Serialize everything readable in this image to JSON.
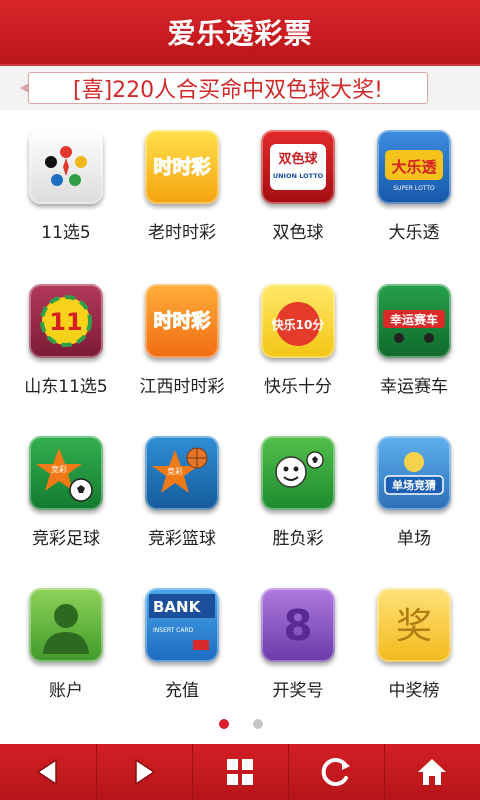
{
  "header": {
    "title": "爱乐透彩票"
  },
  "ticker": {
    "text": "[喜]220人合买命中双色球大奖!"
  },
  "games": [
    {
      "label": "11选5",
      "icon": "11x5-logo-icon"
    },
    {
      "label": "老时时彩",
      "icon": "shishicai-logo-icon",
      "icon_text": "时时彩"
    },
    {
      "label": "双色球",
      "icon": "union-lotto-logo-icon",
      "icon_text": "双色球",
      "icon_sub": "UNION LOTTO"
    },
    {
      "label": "大乐透",
      "icon": "super-lotto-logo-icon",
      "icon_text": "大乐透",
      "icon_sub": "SUPER LOTTO"
    },
    {
      "label": "山东11选5",
      "icon": "shandong-11x5-logo-icon",
      "icon_text": "11"
    },
    {
      "label": "江西时时彩",
      "icon": "jiangxi-shishicai-logo-icon",
      "icon_text": "时时彩"
    },
    {
      "label": "快乐十分",
      "icon": "kuaile-shifen-logo-icon",
      "icon_text": "快乐10分"
    },
    {
      "label": "幸运赛车",
      "icon": "lucky-racing-logo-icon",
      "icon_text": "幸运赛车"
    },
    {
      "label": "竞彩足球",
      "icon": "soccer-logo-icon",
      "icon_text": "竞彩"
    },
    {
      "label": "竞彩篮球",
      "icon": "basketball-logo-icon",
      "icon_text": "竞彩"
    },
    {
      "label": "胜负彩",
      "icon": "win-lose-logo-icon"
    },
    {
      "label": "单场",
      "icon": "single-match-logo-icon",
      "icon_text": "单场竞猜"
    },
    {
      "label": "账户",
      "icon": "account-icon"
    },
    {
      "label": "充值",
      "icon": "bank-card-icon",
      "icon_text": "BANK",
      "icon_sub": "INSERT CARD"
    },
    {
      "label": "开奖号",
      "icon": "draw-number-icon",
      "icon_text": "8"
    },
    {
      "label": "中奖榜",
      "icon": "prize-list-icon",
      "icon_text": "奖"
    }
  ],
  "pager": {
    "total": 2,
    "active": 1,
    "active_color": "#d8202a",
    "inactive_color": "#c6c6c6"
  },
  "bottom_nav": [
    {
      "name": "back-button",
      "icon": "arrow-left-icon"
    },
    {
      "name": "forward-button",
      "icon": "arrow-right-icon"
    },
    {
      "name": "grid-menu-button",
      "icon": "grid-icon"
    },
    {
      "name": "refresh-button",
      "icon": "refresh-icon"
    },
    {
      "name": "home-button",
      "icon": "home-icon"
    }
  ],
  "colors": {
    "brand_red": "#c81c20",
    "ticker_text": "#d22a2a"
  }
}
